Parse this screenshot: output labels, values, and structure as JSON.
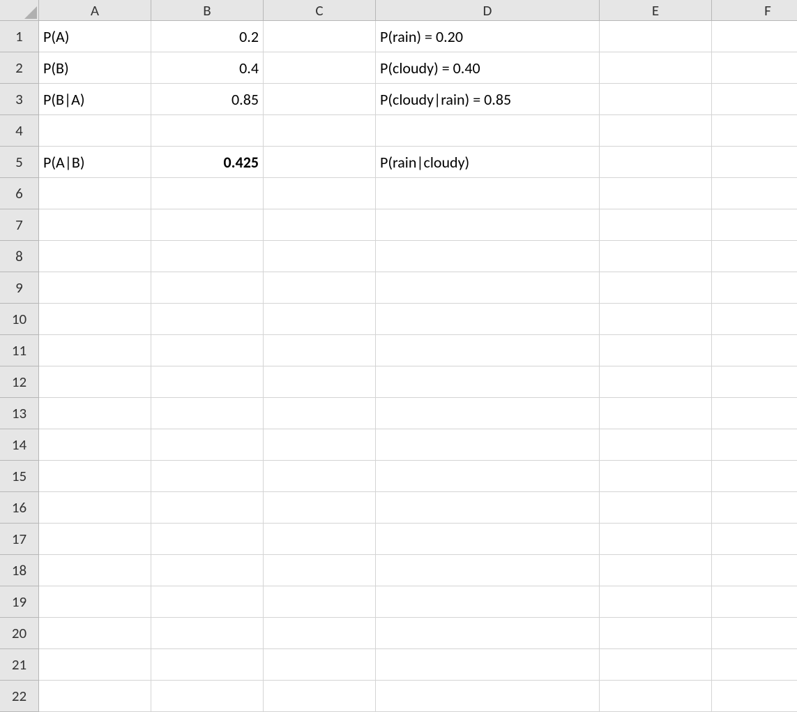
{
  "columns": [
    "A",
    "B",
    "C",
    "D",
    "E",
    "F"
  ],
  "rowCount": 22,
  "cells": {
    "A1": {
      "value": "P(A)",
      "align": "left"
    },
    "B1": {
      "value": "0.2",
      "align": "right"
    },
    "D1": {
      "value": "P(rain) = 0.20",
      "align": "left"
    },
    "A2": {
      "value": "P(B)",
      "align": "left"
    },
    "B2": {
      "value": "0.4",
      "align": "right"
    },
    "D2": {
      "value": "P(cloudy) = 0.40",
      "align": "left"
    },
    "A3": {
      "value": "P(B|A)",
      "align": "left"
    },
    "B3": {
      "value": "0.85",
      "align": "right"
    },
    "D3": {
      "value": "P(cloudy|rain) = 0.85",
      "align": "left"
    },
    "A5": {
      "value": "P(A|B)",
      "align": "left"
    },
    "B5": {
      "value": "0.425",
      "align": "right",
      "bold": true
    },
    "D5": {
      "value": "P(rain|cloudy)",
      "align": "left"
    }
  }
}
